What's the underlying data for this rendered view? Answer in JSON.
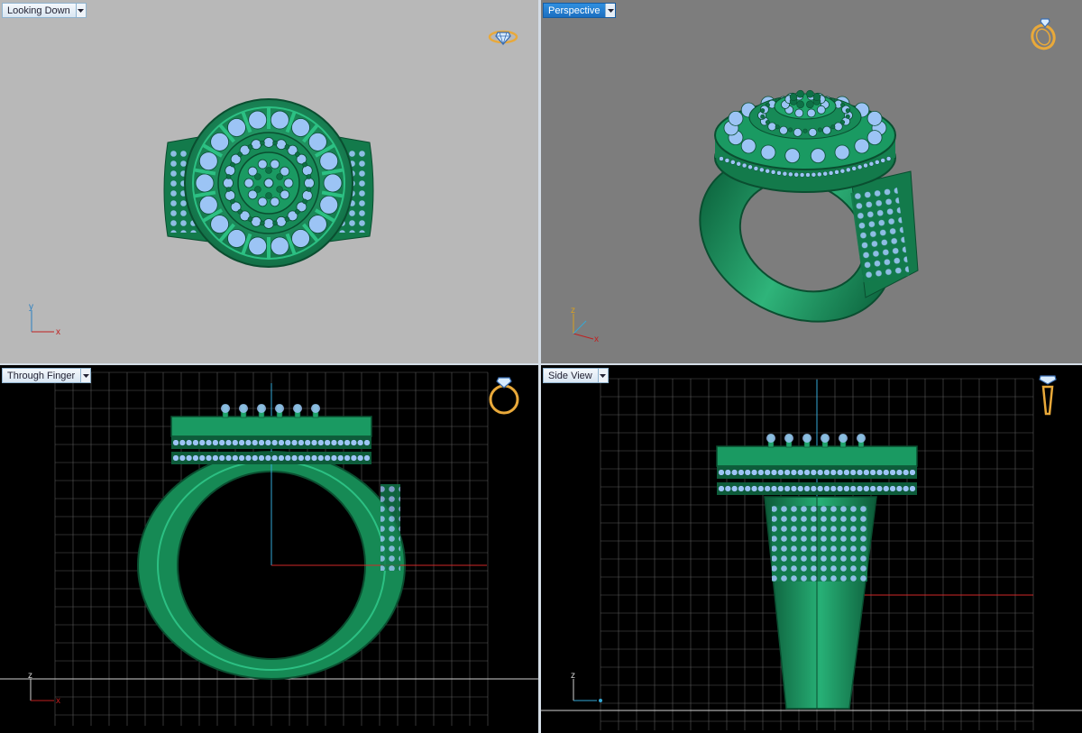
{
  "viewports": {
    "top": {
      "label": "Looking Down",
      "active": false
    },
    "perspective": {
      "label": "Perspective",
      "active": true
    },
    "front": {
      "label": "Through Finger",
      "active": false
    },
    "side": {
      "label": "Side View",
      "active": false
    }
  },
  "axes": {
    "top": {
      "v": "y",
      "h": "x"
    },
    "perspective": {
      "v": "z",
      "h": "x"
    },
    "front": {
      "v": "z",
      "h": "x"
    },
    "side": {
      "v": "z",
      "h": ""
    }
  },
  "icons": {
    "top": "ring-top-view-icon",
    "perspective": "ring-perspective-icon",
    "front": "ring-front-view-icon",
    "side": "ring-side-view-icon"
  },
  "colors": {
    "metal": "#1f9a66",
    "metal_dark": "#0f6a42",
    "stone": "#9cc4f5",
    "top_bg": "#b8b8b8",
    "perspective_bg": "#7d7d7d",
    "ortho_bg": "#000000",
    "grid": "#5a5a5a",
    "axis_y": "#35a9d6",
    "axis_x": "#d02828",
    "icon_gold": "#e9a93a"
  }
}
